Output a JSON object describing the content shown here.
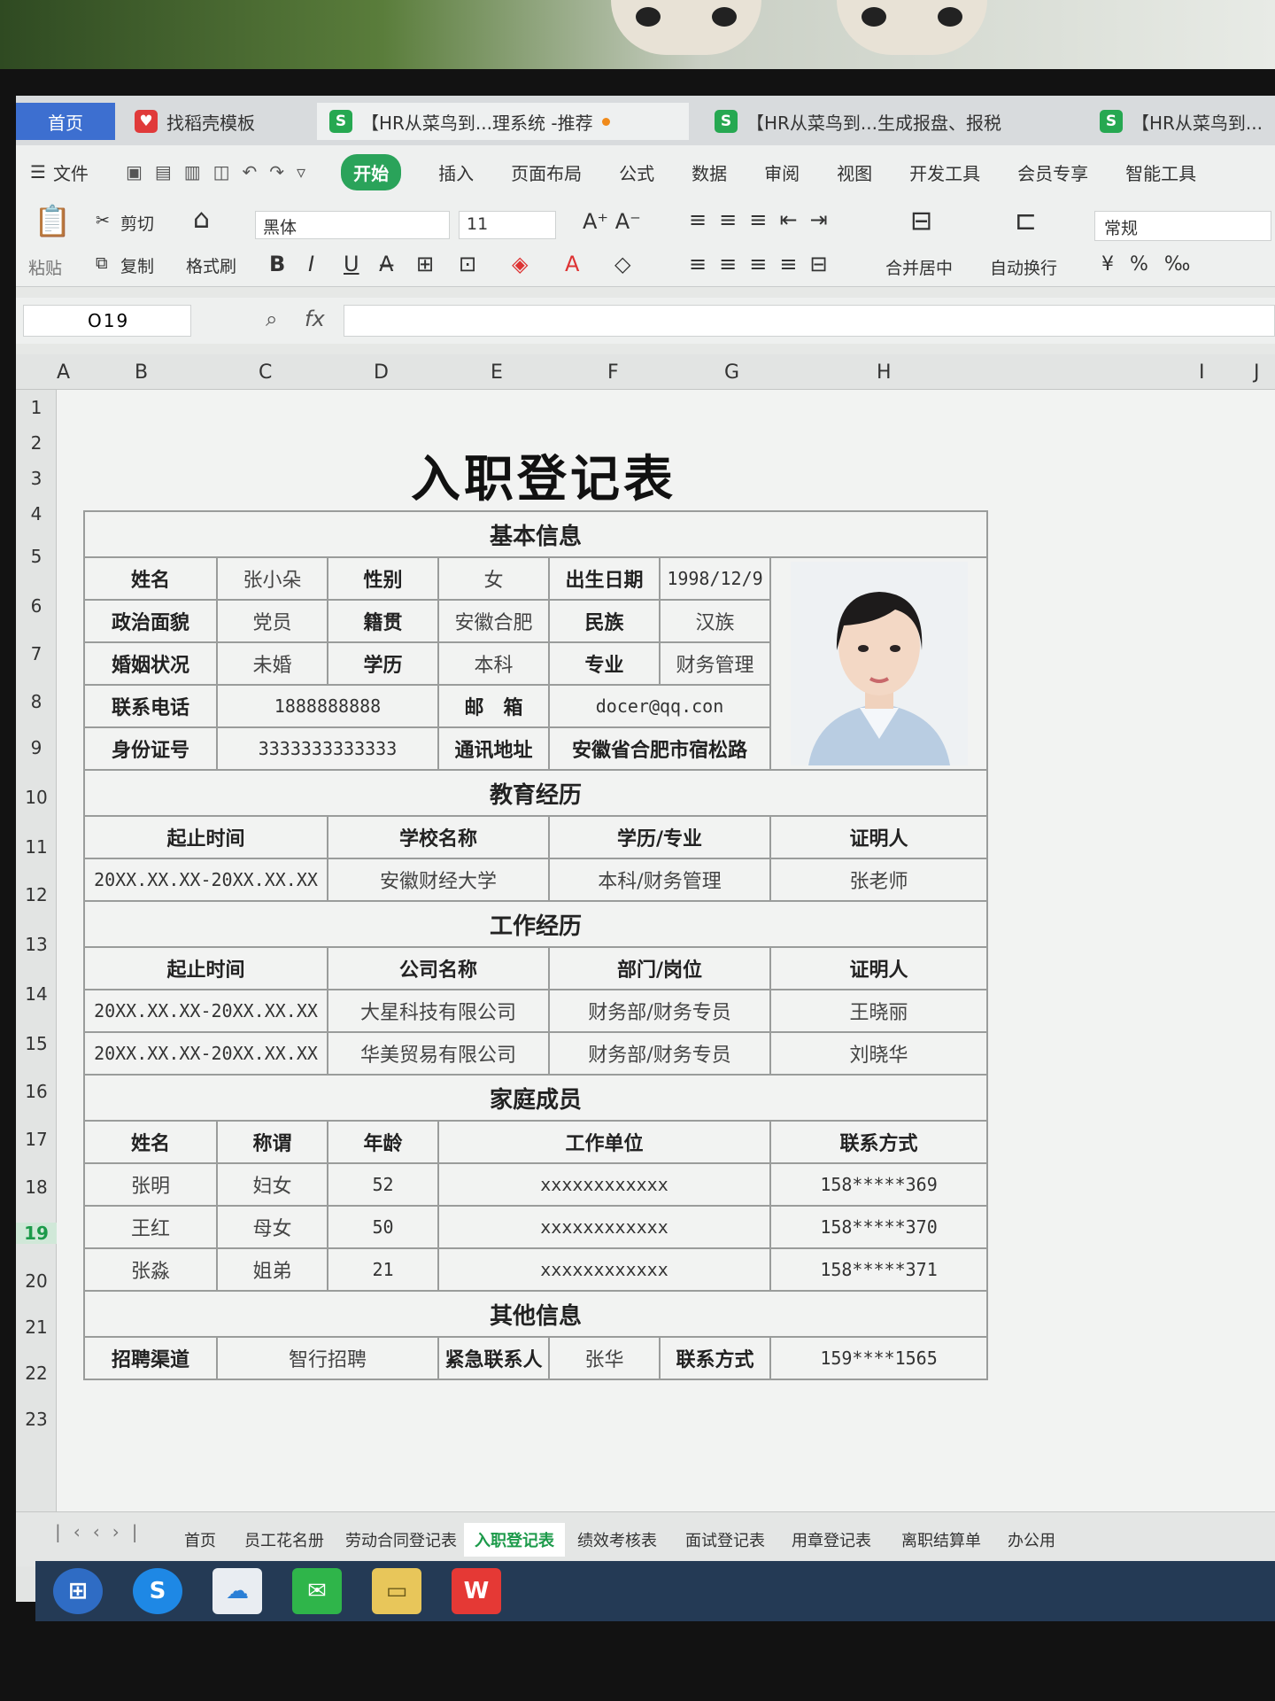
{
  "tabs": [
    {
      "label": "首页"
    },
    {
      "label": "找稻壳模板"
    },
    {
      "label": "【HR从菜鸟到...理系统 -推荐"
    },
    {
      "label": "【HR从菜鸟到...生成报盘、报税"
    },
    {
      "label": "【HR从菜鸟到..."
    }
  ],
  "menu": [
    "文件",
    "开始",
    "插入",
    "页面布局",
    "公式",
    "数据",
    "审阅",
    "视图",
    "开发工具",
    "会员专享",
    "智能工具"
  ],
  "ribbon": {
    "cut": "剪切",
    "copy": "复制",
    "format_painter": "格式刷",
    "paste": "粘贴",
    "font": "黑体",
    "size": "11",
    "merge": "合并居中",
    "wrap": "自动换行",
    "number_format": "常规"
  },
  "formula_bar": {
    "cell": "O19",
    "fx": "fx"
  },
  "columns": [
    "A",
    "B",
    "C",
    "D",
    "E",
    "F",
    "G",
    "H",
    "I",
    "J"
  ],
  "rows": [
    "1",
    "2",
    "3",
    "4",
    "5",
    "6",
    "7",
    "8",
    "9",
    "10",
    "11",
    "12",
    "13",
    "14",
    "15",
    "16",
    "17",
    "18",
    "19",
    "20",
    "21",
    "22",
    "23"
  ],
  "selected_row": "19",
  "title": "入职登记表",
  "basic": {
    "section": "基本信息",
    "name_label": "姓名",
    "name": "张小朵",
    "gender_label": "性别",
    "gender": "女",
    "birth_label": "出生日期",
    "birth": "1998/12/9",
    "political_label": "政治面貌",
    "political": "党员",
    "native_label": "籍贯",
    "native": "安徽合肥",
    "ethnic_label": "民族",
    "ethnic": "汉族",
    "marital_label": "婚姻状况",
    "marital": "未婚",
    "edu_label": "学历",
    "edu": "本科",
    "major_label": "专业",
    "major": "财务管理",
    "phone_label": "联系电话",
    "phone": "1888888888",
    "email_label": "邮　箱",
    "email": "docer@qq.con",
    "id_label": "身份证号",
    "id": "3333333333333",
    "address_label": "通讯地址",
    "address": "安徽省合肥市宿松路"
  },
  "education": {
    "section": "教育经历",
    "headers": [
      "起止时间",
      "学校名称",
      "学历/专业",
      "证明人"
    ],
    "rows": [
      [
        "20XX.XX.XX-20XX.XX.XX",
        "安徽财经大学",
        "本科/财务管理",
        "张老师"
      ]
    ]
  },
  "work": {
    "section": "工作经历",
    "headers": [
      "起止时间",
      "公司名称",
      "部门/岗位",
      "证明人"
    ],
    "rows": [
      [
        "20XX.XX.XX-20XX.XX.XX",
        "大星科技有限公司",
        "财务部/财务专员",
        "王晓丽"
      ],
      [
        "20XX.XX.XX-20XX.XX.XX",
        "华美贸易有限公司",
        "财务部/财务专员",
        "刘晓华"
      ]
    ]
  },
  "family": {
    "section": "家庭成员",
    "headers": [
      "姓名",
      "称谓",
      "年龄",
      "工作单位",
      "联系方式"
    ],
    "rows": [
      [
        "张明",
        "妇女",
        "52",
        "xxxxxxxxxxxx",
        "158*****369"
      ],
      [
        "王红",
        "母女",
        "50",
        "xxxxxxxxxxxx",
        "158*****370"
      ],
      [
        "张淼",
        "姐弟",
        "21",
        "xxxxxxxxxxxx",
        "158*****371"
      ]
    ]
  },
  "other": {
    "section": "其他信息",
    "channel_label": "招聘渠道",
    "channel": "智行招聘",
    "emergency_label": "紧急联系人",
    "emergency": "张华",
    "contact_label": "联系方式",
    "contact": "159****1565"
  },
  "sheet_tabs": [
    "首页",
    "员工花名册",
    "劳动合同登记表",
    "入职登记表",
    "绩效考核表",
    "面试登记表",
    "用章登记表",
    "离职结算单",
    "办公用"
  ],
  "active_sheet": "入职登记表",
  "colors": {
    "accent": "#2aa35a",
    "home_tab": "#3d6fd0"
  }
}
